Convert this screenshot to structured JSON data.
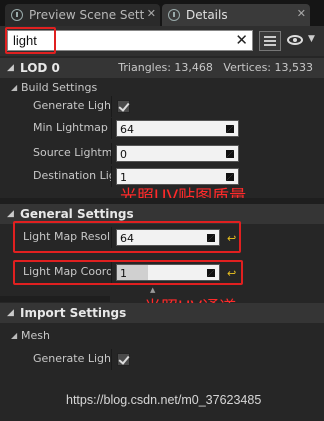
{
  "tabs": [
    {
      "label": "Preview Scene Sett",
      "close": "✕"
    },
    {
      "label": "Details",
      "close": "✕"
    }
  ],
  "search": {
    "value": "light",
    "clear": "✕"
  },
  "lod": {
    "title": "LOD 0",
    "triangles": "Triangles: 13,468",
    "vertices": "Vertices: 13,533"
  },
  "build_settings": {
    "title": "Build Settings",
    "rows": [
      {
        "label": "Generate Lightmap",
        "value": "checked"
      },
      {
        "label": "Min Lightmap Resolution",
        "value": "64"
      },
      {
        "label": "Source Lightmap Index",
        "value": "0"
      },
      {
        "label": "Destination Lightmap Index",
        "value": "1"
      }
    ]
  },
  "general_settings": {
    "title": "General Settings",
    "light_map_resolution": {
      "label": "Light Map Resolution",
      "value": "64",
      "reset": "↩"
    },
    "light_map_coordinate": {
      "label": "Light Map Coordinate Index",
      "value": "1",
      "reset": "↩",
      "slider_fraction": 0.3
    }
  },
  "import_settings": {
    "title": "Import Settings",
    "mesh": {
      "title": "Mesh",
      "rows": [
        {
          "label": "Generate Lightmap UVs",
          "value": "checked"
        }
      ]
    }
  },
  "annotations": {
    "uv_quality": "光照UV贴图质量",
    "uv_channel": "光照UV通道"
  },
  "watermark": "https://blog.csdn.net/m0_37623485",
  "colors": {
    "annotation_red": "#e02020",
    "reset_yellow": "#e8c020",
    "background": "#262626"
  }
}
